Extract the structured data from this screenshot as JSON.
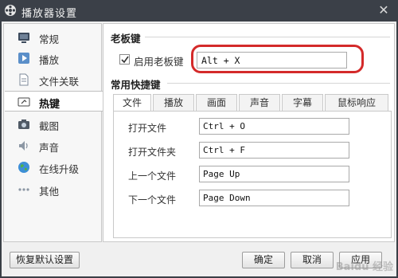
{
  "window": {
    "title": "播放器设置",
    "close_glyph": "✕",
    "title_bg": "#3b4048"
  },
  "sidebar": {
    "items": [
      {
        "label": "常规",
        "icon": "monitor-icon"
      },
      {
        "label": "播放",
        "icon": "play-icon"
      },
      {
        "label": "文件关联",
        "icon": "document-icon"
      },
      {
        "label": "热键",
        "icon": "keyboard-icon",
        "active": true
      },
      {
        "label": "截图",
        "icon": "camera-icon"
      },
      {
        "label": "声音",
        "icon": "speaker-icon"
      },
      {
        "label": "在线升级",
        "icon": "globe-icon"
      },
      {
        "label": "其他",
        "icon": "more-icon"
      }
    ]
  },
  "boss_key": {
    "section_title": "老板键",
    "checkbox_label": "启用老板键",
    "checked": true,
    "value": "Alt + X",
    "highlight_color": "#d42a2a"
  },
  "shortcuts": {
    "section_title": "常用快捷键",
    "tabs": [
      "文件",
      "播放",
      "画面",
      "声音",
      "字幕",
      "鼠标响应"
    ],
    "active_tab": "文件",
    "rows": [
      {
        "label": "打开文件",
        "value": "Ctrl + O"
      },
      {
        "label": "打开文件夹",
        "value": "Ctrl + F"
      },
      {
        "label": "上一个文件",
        "value": "Page Up"
      },
      {
        "label": "下一个文件",
        "value": "Page Down"
      }
    ]
  },
  "footer": {
    "restore_label": "恢复默认设置",
    "ok_label": "确定",
    "cancel_label": "取消",
    "apply_label": "应用"
  },
  "watermark": "Baidu 经验"
}
